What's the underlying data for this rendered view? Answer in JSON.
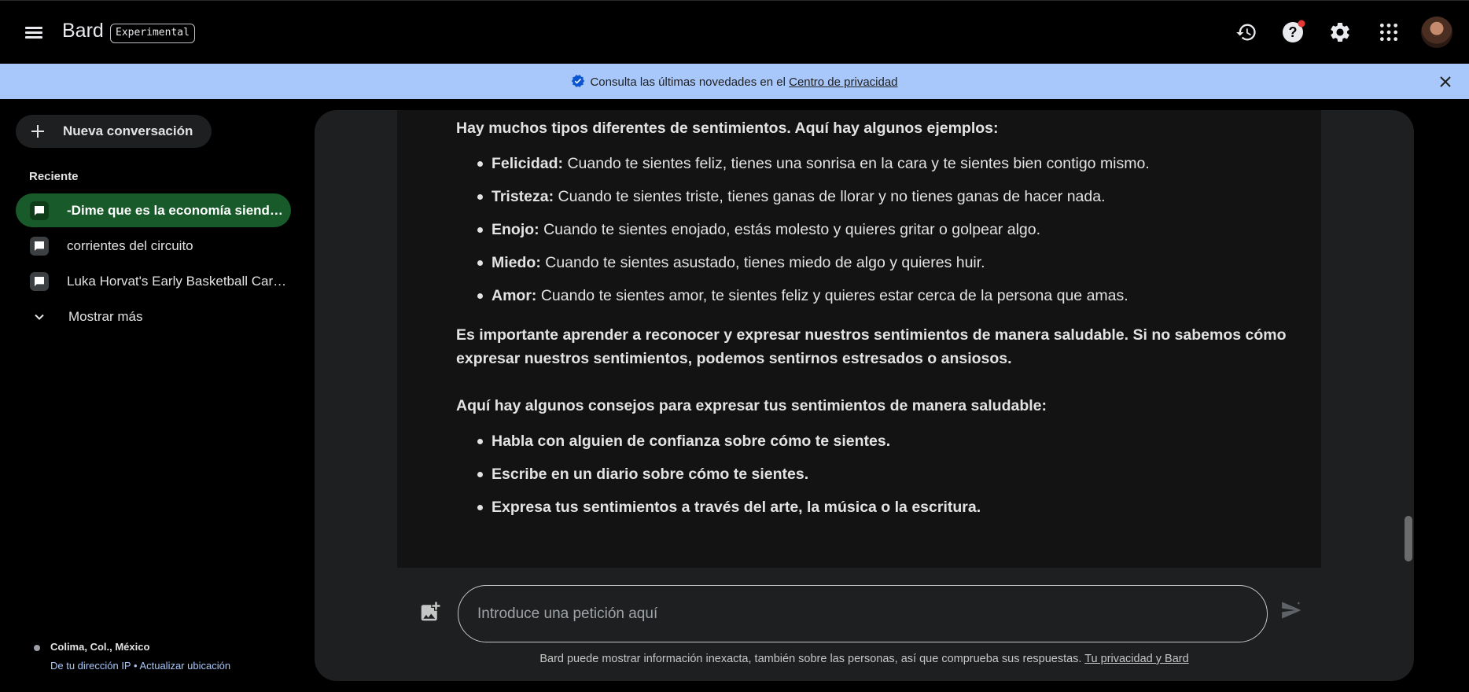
{
  "header": {
    "brand": "Bard",
    "badge": "Experimental",
    "icons": [
      "menu-icon",
      "history-icon",
      "help-icon",
      "settings-icon",
      "apps-grid-icon",
      "avatar"
    ],
    "help_notification_color": "#e53935"
  },
  "banner": {
    "text": "Consulta las últimas novedades en el ",
    "link": "Centro de privacidad",
    "background": "#a8c7fa"
  },
  "sidebar": {
    "new_chat": "Nueva conversación",
    "recent_title": "Reciente",
    "items": [
      {
        "label": "-Dime que es la economía sienda una persona experta",
        "active": true
      },
      {
        "label": "corrientes del circuito",
        "active": false
      },
      {
        "label": "Luka Horvat's Early Basketball Career",
        "active": false
      }
    ],
    "show_more": "Mostrar más",
    "location": {
      "place": "Colima, Col., México",
      "ip_link": "De tu dirección IP",
      "separator": " • ",
      "update_link": "Actualizar ubicación"
    }
  },
  "response": {
    "intro": "Hay muchos tipos diferentes de sentimientos. Aquí hay algunos ejemplos:",
    "feelings": [
      {
        "term": "Felicidad:",
        "text": " Cuando te sientes feliz, tienes una sonrisa en la cara y te sientes bien contigo mismo."
      },
      {
        "term": "Tristeza:",
        "text": " Cuando te sientes triste, tienes ganas de llorar y no tienes ganas de hacer nada."
      },
      {
        "term": "Enojo:",
        "text": " Cuando te sientes enojado, estás molesto y quieres gritar o golpear algo."
      },
      {
        "term": "Miedo:",
        "text": " Cuando te sientes asustado, tienes miedo de algo y quieres huir."
      },
      {
        "term": "Amor:",
        "text": " Cuando te sientes amor, te sientes feliz y quieres estar cerca de la persona que amas."
      }
    ],
    "importance": "Es importante aprender a reconocer y expresar nuestros sentimientos de manera saludable. Si no sabemos cómo expresar nuestros sentimientos, podemos sentirnos estresados o ansiosos.",
    "tips_intro": "Aquí hay algunos consejos para expresar tus sentimientos de manera saludable:",
    "tips": [
      "Habla con alguien de confianza sobre cómo te sientes.",
      "Escribe en un diario sobre cómo te sientes.",
      "Expresa tus sentimientos a través del arte, la música o la escritura."
    ]
  },
  "composer": {
    "placeholder": "Introduce una petición aquí",
    "disclaimer": "Bard puede mostrar información inexacta, también sobre las personas, así que comprueba sus respuestas. ",
    "disclaimer_link": "Tu privacidad y Bard"
  }
}
